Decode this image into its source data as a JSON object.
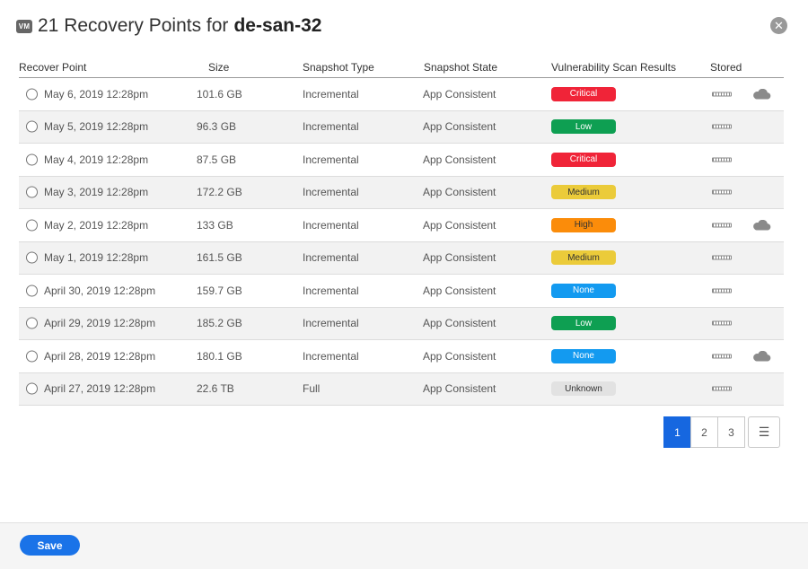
{
  "header": {
    "badge": "VM",
    "title_prefix": "21 Recovery Points for",
    "title_name": "de-san-32",
    "close_icon": "close-icon",
    "close_symbol": "✕"
  },
  "table": {
    "columns": [
      "Recover Point",
      "Size",
      "Snapshot Type",
      "Snapshot State",
      "Vulnerability Scan Results",
      "Stored"
    ],
    "rows": [
      {
        "date": "May 6, 2019  12:28pm",
        "size": "101.6 GB",
        "type": "Incremental",
        "state": "App Consistent",
        "scan": "Critical",
        "cloud": true
      },
      {
        "date": "May 5, 2019  12:28pm",
        "size": "96.3 GB",
        "type": "Incremental",
        "state": "App Consistent",
        "scan": "Low",
        "cloud": false
      },
      {
        "date": "May 4, 2019  12:28pm",
        "size": "87.5 GB",
        "type": "Incremental",
        "state": "App Consistent",
        "scan": "Critical",
        "cloud": false
      },
      {
        "date": "May 3, 2019  12:28pm",
        "size": "172.2 GB",
        "type": "Incremental",
        "state": "App Consistent",
        "scan": "Medium",
        "cloud": false
      },
      {
        "date": "May 2, 2019  12:28pm",
        "size": "133 GB",
        "type": "Incremental",
        "state": "App Consistent",
        "scan": "High",
        "cloud": true
      },
      {
        "date": "May 1, 2019  12:28pm",
        "size": "161.5 GB",
        "type": "Incremental",
        "state": "App Consistent",
        "scan": "Medium",
        "cloud": false
      },
      {
        "date": "April 30, 2019  12:28pm",
        "size": "159.7 GB",
        "type": "Incremental",
        "state": "App Consistent",
        "scan": "None",
        "cloud": false
      },
      {
        "date": "April 29, 2019  12:28pm",
        "size": "185.2 GB",
        "type": "Incremental",
        "state": "App Consistent",
        "scan": "Low",
        "cloud": false
      },
      {
        "date": "April 28, 2019  12:28pm",
        "size": "180.1 GB",
        "type": "Incremental",
        "state": "App Consistent",
        "scan": "None",
        "cloud": true
      },
      {
        "date": "April 27, 2019  12:28pm",
        "size": "22.6 TB",
        "type": "Full",
        "state": "App Consistent",
        "scan": "Unknown",
        "cloud": false
      }
    ]
  },
  "icons": {
    "radio": "radio-button-icon",
    "storage": "local-storage-icon",
    "cloud": "cloud-icon",
    "list": "list-icon"
  },
  "colors": {
    "critical": "#f02438",
    "low": "#0e9f52",
    "medium": "#ebcb3a",
    "high": "#fb8c0a",
    "none": "#139af0",
    "unknown": "#e2e2e2",
    "primary": "#1667e0"
  },
  "pagination": {
    "pages": [
      "1",
      "2",
      "3"
    ],
    "active": "1",
    "list_symbol": "☰"
  },
  "footer": {
    "save_label": "Save"
  }
}
